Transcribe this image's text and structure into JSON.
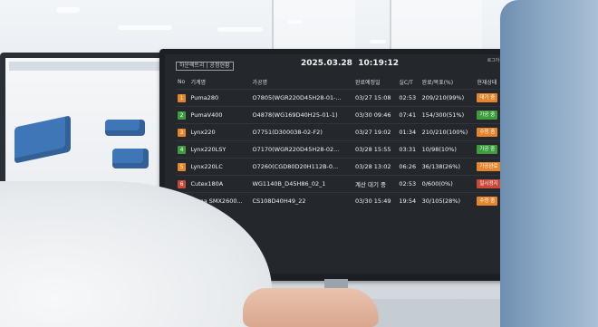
{
  "dashboard": {
    "logo": "하운렉트리 | 공정현황",
    "date": "2025.03.28",
    "time": "10:19:12",
    "login": "로그아웃",
    "columns": [
      "No",
      "기계명",
      "가공명",
      "완료예정일",
      "실C/T",
      "완료/목표(%)",
      "현재상태"
    ],
    "rows": [
      {
        "no": "1",
        "machine": "Puma280",
        "program": "O7805(WGR220D45H28-01-...",
        "due": "03/27 15:08",
        "ct": "02:53",
        "progress": "209/210(99%)",
        "status": "대기 중",
        "color": "#e5862c"
      },
      {
        "no": "2",
        "machine": "PumaV400",
        "program": "O4878(WG169D40H25-01-1)",
        "due": "03/30 09:46",
        "ct": "07:41",
        "progress": "154/300(51%)",
        "status": "가공 중",
        "color": "#3e9c3f"
      },
      {
        "no": "3",
        "machine": "Lynx220",
        "program": "O7751(D300038-02-F2)",
        "due": "03/27 19:02",
        "ct": "01:34",
        "progress": "210/210(100%)",
        "status": "수정 중",
        "color": "#e5862c"
      },
      {
        "no": "4",
        "machine": "Lynx220LSY",
        "program": "O7170(WGR220D45H28-02...",
        "due": "03/28 15:55",
        "ct": "03:31",
        "progress": "10/98(10%)",
        "status": "가공 중",
        "color": "#3e9c3f"
      },
      {
        "no": "5",
        "machine": "Lynx220LC",
        "program": "O7260(CGD80D20H112B-0...",
        "due": "03/28 13:02",
        "ct": "06:26",
        "progress": "36/138(26%)",
        "status": "가공완료",
        "color": "#e5862c"
      },
      {
        "no": "6",
        "machine": "Cutex180A",
        "program": "WG1140B_D45H86_02_1",
        "due": "계산 대기 중",
        "ct": "02:53",
        "progress": "0/600(0%)",
        "status": "일시정지",
        "color": "#c9493a"
      },
      {
        "no": "7",
        "machine": "Puma SMX2600...",
        "program": "CS108D40H49_22",
        "due": "03/30 15:49",
        "ct": "19:54",
        "progress": "30/105(28%)",
        "status": "수정 중",
        "color": "#e5862c"
      }
    ]
  }
}
